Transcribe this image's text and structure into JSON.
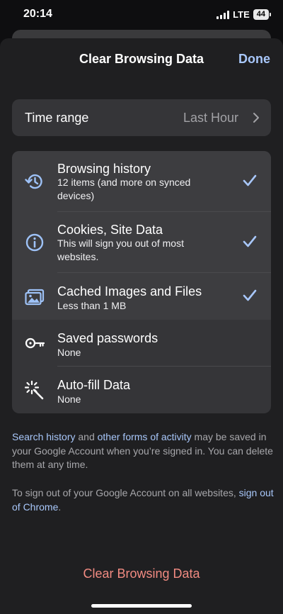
{
  "status": {
    "time": "20:14",
    "network": "LTE",
    "battery": "44"
  },
  "header": {
    "title": "Clear Browsing Data",
    "done_label": "Done"
  },
  "time_range": {
    "label": "Time range",
    "value": "Last Hour"
  },
  "items": [
    {
      "title": "Browsing history",
      "subtitle": "12 items (and more on synced devices)",
      "icon": "history-icon",
      "checked": true
    },
    {
      "title": "Cookies, Site Data",
      "subtitle": "This will sign you out of most websites.",
      "icon": "info-icon",
      "checked": true
    },
    {
      "title": "Cached Images and Files",
      "subtitle": "Less than 1 MB",
      "icon": "image-icon",
      "checked": true
    },
    {
      "title": "Saved passwords",
      "subtitle": "None",
      "icon": "key-icon",
      "checked": false
    },
    {
      "title": "Auto-fill Data",
      "subtitle": "None",
      "icon": "magic-wand-icon",
      "checked": false
    }
  ],
  "info1": {
    "link1": "Search history",
    "text1": " and ",
    "link2": "other forms of activity",
    "text2": " may be saved in your Google Account when you’re signed in. You can delete them at any time."
  },
  "info2": {
    "text1": "To sign out of your Google Account on all websites, ",
    "link": "sign out of Chrome",
    "text2": "."
  },
  "clear_button": "Clear Browsing Data",
  "colors": {
    "accent": "#a8c7fa",
    "destructive": "#f28b82",
    "sheet_bg": "#1f1f21",
    "group_bg": "#353538"
  }
}
